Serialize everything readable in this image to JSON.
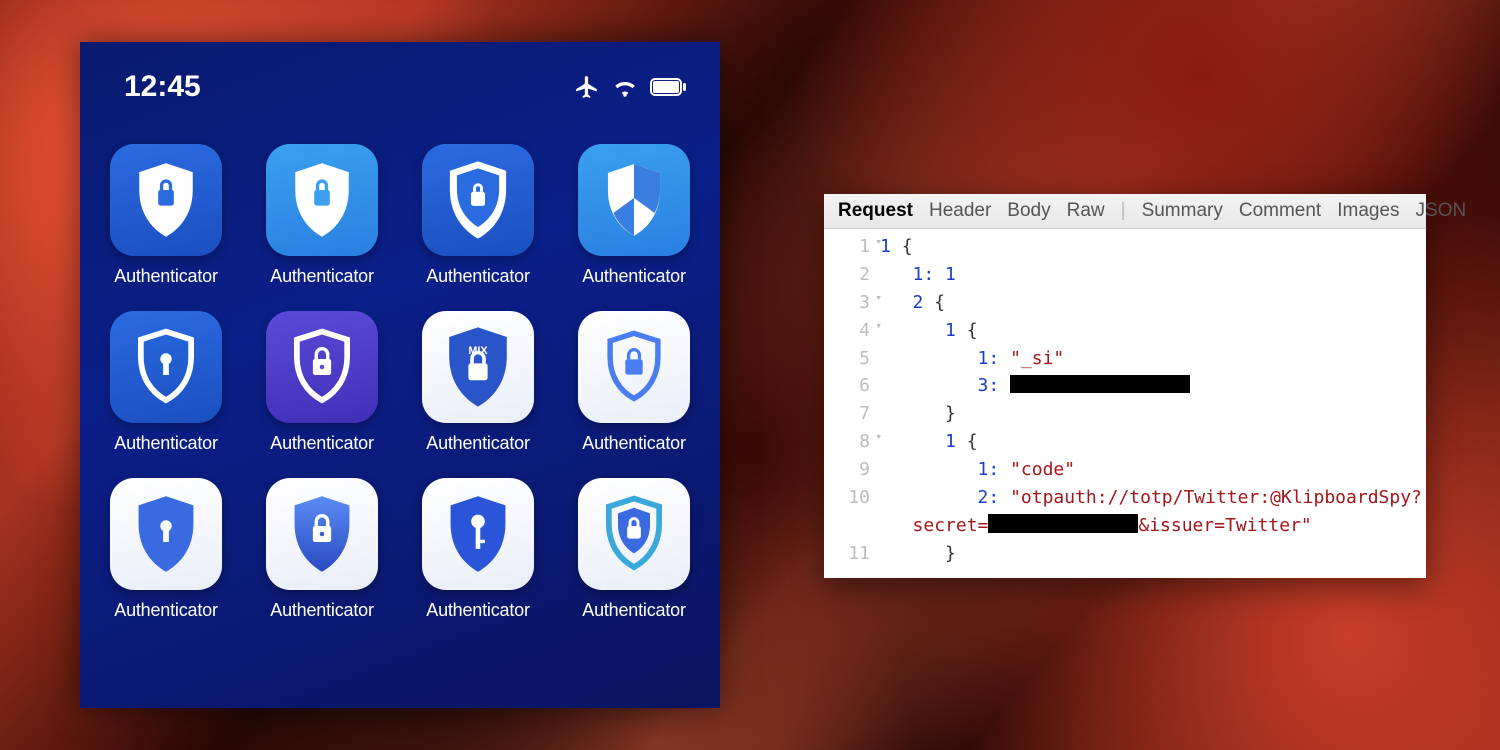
{
  "phone": {
    "statusbar": {
      "time": "12:45"
    },
    "apps": [
      {
        "label": "Authenticator"
      },
      {
        "label": "Authenticator"
      },
      {
        "label": "Authenticator"
      },
      {
        "label": "Authenticator"
      },
      {
        "label": "Authenticator"
      },
      {
        "label": "Authenticator"
      },
      {
        "label": "Authenticator"
      },
      {
        "label": "Authenticator"
      },
      {
        "label": "Authenticator"
      },
      {
        "label": "Authenticator"
      },
      {
        "label": "Authenticator"
      },
      {
        "label": "Authenticator"
      }
    ],
    "mix_badge": "MIX"
  },
  "panel": {
    "tabs": [
      "Request",
      "Header",
      "Body",
      "Raw",
      "Summary",
      "Comment",
      "Images",
      "JSON"
    ],
    "active_tab": "Request",
    "lines": {
      "l1": {
        "num": "1",
        "txt_a": "1",
        "txt_b": "{"
      },
      "l2": {
        "num": "2",
        "k": "1:",
        "v": "1"
      },
      "l3": {
        "num": "3",
        "txt_a": "2",
        "txt_b": "{"
      },
      "l4": {
        "num": "4",
        "txt_a": "1",
        "txt_b": "{"
      },
      "l5": {
        "num": "5",
        "k": "1:",
        "v": "\"_si\""
      },
      "l6": {
        "num": "6",
        "k": "3:"
      },
      "l7": {
        "num": "7",
        "txt": "}"
      },
      "l8": {
        "num": "8",
        "txt_a": "1",
        "txt_b": "{"
      },
      "l9": {
        "num": "9",
        "k": "1:",
        "v": "\"code\""
      },
      "l10": {
        "num": "10",
        "k": "2:",
        "v_a": "\"otpauth://totp/Twitter:@KlipboardSpy?",
        "v_b": "secret=",
        "v_c": "&issuer=Twitter\""
      },
      "l11": {
        "num": "11",
        "txt": "}"
      }
    }
  }
}
